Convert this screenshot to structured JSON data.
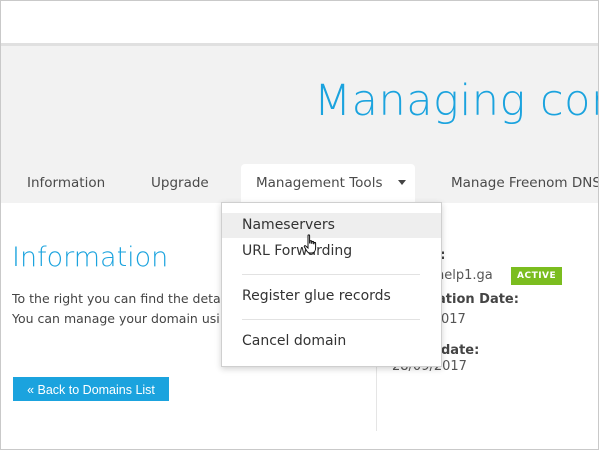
{
  "header": {
    "title": "Managing conto"
  },
  "tabs": [
    {
      "label": "Information"
    },
    {
      "label": "Upgrade"
    },
    {
      "label": "Management Tools"
    },
    {
      "label": "Manage Freenom DNS"
    }
  ],
  "dropdown": {
    "items": [
      {
        "label": "Nameservers"
      },
      {
        "label": "URL Forwarding"
      },
      {
        "label": "Register glue records"
      },
      {
        "label": "Cancel domain"
      }
    ]
  },
  "info": {
    "title": "Information",
    "line1": "To the right you can find the deta",
    "line2": "You can manage your domain usi",
    "back_button": "« Back to Domains List"
  },
  "side": {
    "domain_label_fragment": "n:",
    "domain_value_fragment": "help1.ga",
    "status_badge": "ACTIVE",
    "reg_date_label_fragment": "ation Date:",
    "reg_date_value_fragment": "017",
    "exp_date_label_fragment": "date:",
    "exp_date_value": "28/09/2017"
  },
  "colors": {
    "accent": "#1ba3de",
    "badge_green": "#7bbd1f"
  }
}
